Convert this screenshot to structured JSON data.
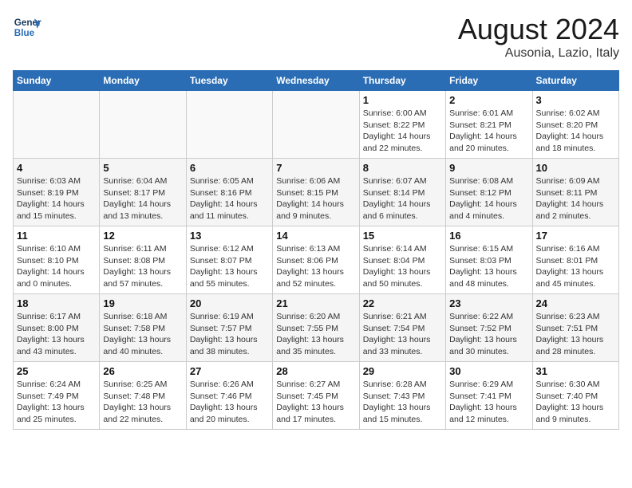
{
  "logo": {
    "line1": "General",
    "line2": "Blue"
  },
  "title": "August 2024",
  "subtitle": "Ausonia, Lazio, Italy",
  "days_header": [
    "Sunday",
    "Monday",
    "Tuesday",
    "Wednesday",
    "Thursday",
    "Friday",
    "Saturday"
  ],
  "weeks": [
    [
      {
        "num": "",
        "info": ""
      },
      {
        "num": "",
        "info": ""
      },
      {
        "num": "",
        "info": ""
      },
      {
        "num": "",
        "info": ""
      },
      {
        "num": "1",
        "info": "Sunrise: 6:00 AM\nSunset: 8:22 PM\nDaylight: 14 hours\nand 22 minutes."
      },
      {
        "num": "2",
        "info": "Sunrise: 6:01 AM\nSunset: 8:21 PM\nDaylight: 14 hours\nand 20 minutes."
      },
      {
        "num": "3",
        "info": "Sunrise: 6:02 AM\nSunset: 8:20 PM\nDaylight: 14 hours\nand 18 minutes."
      }
    ],
    [
      {
        "num": "4",
        "info": "Sunrise: 6:03 AM\nSunset: 8:19 PM\nDaylight: 14 hours\nand 15 minutes."
      },
      {
        "num": "5",
        "info": "Sunrise: 6:04 AM\nSunset: 8:17 PM\nDaylight: 14 hours\nand 13 minutes."
      },
      {
        "num": "6",
        "info": "Sunrise: 6:05 AM\nSunset: 8:16 PM\nDaylight: 14 hours\nand 11 minutes."
      },
      {
        "num": "7",
        "info": "Sunrise: 6:06 AM\nSunset: 8:15 PM\nDaylight: 14 hours\nand 9 minutes."
      },
      {
        "num": "8",
        "info": "Sunrise: 6:07 AM\nSunset: 8:14 PM\nDaylight: 14 hours\nand 6 minutes."
      },
      {
        "num": "9",
        "info": "Sunrise: 6:08 AM\nSunset: 8:12 PM\nDaylight: 14 hours\nand 4 minutes."
      },
      {
        "num": "10",
        "info": "Sunrise: 6:09 AM\nSunset: 8:11 PM\nDaylight: 14 hours\nand 2 minutes."
      }
    ],
    [
      {
        "num": "11",
        "info": "Sunrise: 6:10 AM\nSunset: 8:10 PM\nDaylight: 14 hours\nand 0 minutes."
      },
      {
        "num": "12",
        "info": "Sunrise: 6:11 AM\nSunset: 8:08 PM\nDaylight: 13 hours\nand 57 minutes."
      },
      {
        "num": "13",
        "info": "Sunrise: 6:12 AM\nSunset: 8:07 PM\nDaylight: 13 hours\nand 55 minutes."
      },
      {
        "num": "14",
        "info": "Sunrise: 6:13 AM\nSunset: 8:06 PM\nDaylight: 13 hours\nand 52 minutes."
      },
      {
        "num": "15",
        "info": "Sunrise: 6:14 AM\nSunset: 8:04 PM\nDaylight: 13 hours\nand 50 minutes."
      },
      {
        "num": "16",
        "info": "Sunrise: 6:15 AM\nSunset: 8:03 PM\nDaylight: 13 hours\nand 48 minutes."
      },
      {
        "num": "17",
        "info": "Sunrise: 6:16 AM\nSunset: 8:01 PM\nDaylight: 13 hours\nand 45 minutes."
      }
    ],
    [
      {
        "num": "18",
        "info": "Sunrise: 6:17 AM\nSunset: 8:00 PM\nDaylight: 13 hours\nand 43 minutes."
      },
      {
        "num": "19",
        "info": "Sunrise: 6:18 AM\nSunset: 7:58 PM\nDaylight: 13 hours\nand 40 minutes."
      },
      {
        "num": "20",
        "info": "Sunrise: 6:19 AM\nSunset: 7:57 PM\nDaylight: 13 hours\nand 38 minutes."
      },
      {
        "num": "21",
        "info": "Sunrise: 6:20 AM\nSunset: 7:55 PM\nDaylight: 13 hours\nand 35 minutes."
      },
      {
        "num": "22",
        "info": "Sunrise: 6:21 AM\nSunset: 7:54 PM\nDaylight: 13 hours\nand 33 minutes."
      },
      {
        "num": "23",
        "info": "Sunrise: 6:22 AM\nSunset: 7:52 PM\nDaylight: 13 hours\nand 30 minutes."
      },
      {
        "num": "24",
        "info": "Sunrise: 6:23 AM\nSunset: 7:51 PM\nDaylight: 13 hours\nand 28 minutes."
      }
    ],
    [
      {
        "num": "25",
        "info": "Sunrise: 6:24 AM\nSunset: 7:49 PM\nDaylight: 13 hours\nand 25 minutes."
      },
      {
        "num": "26",
        "info": "Sunrise: 6:25 AM\nSunset: 7:48 PM\nDaylight: 13 hours\nand 22 minutes."
      },
      {
        "num": "27",
        "info": "Sunrise: 6:26 AM\nSunset: 7:46 PM\nDaylight: 13 hours\nand 20 minutes."
      },
      {
        "num": "28",
        "info": "Sunrise: 6:27 AM\nSunset: 7:45 PM\nDaylight: 13 hours\nand 17 minutes."
      },
      {
        "num": "29",
        "info": "Sunrise: 6:28 AM\nSunset: 7:43 PM\nDaylight: 13 hours\nand 15 minutes."
      },
      {
        "num": "30",
        "info": "Sunrise: 6:29 AM\nSunset: 7:41 PM\nDaylight: 13 hours\nand 12 minutes."
      },
      {
        "num": "31",
        "info": "Sunrise: 6:30 AM\nSunset: 7:40 PM\nDaylight: 13 hours\nand 9 minutes."
      }
    ]
  ]
}
